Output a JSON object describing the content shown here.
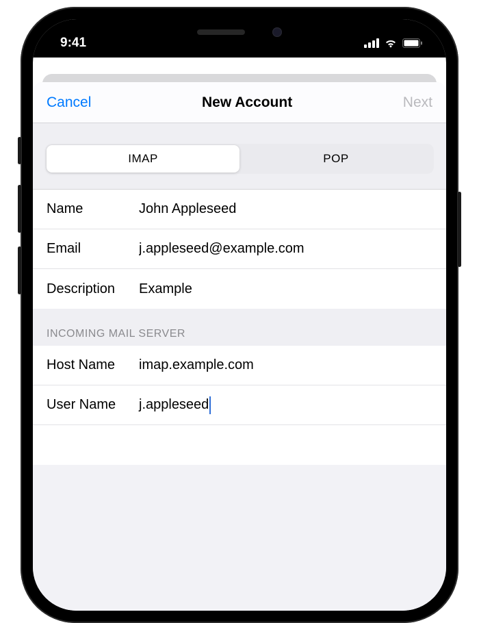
{
  "status": {
    "time": "9:41"
  },
  "nav": {
    "cancel": "Cancel",
    "title": "New Account",
    "next": "Next"
  },
  "segmented": {
    "imap": "IMAP",
    "pop": "POP",
    "active": "IMAP"
  },
  "account": {
    "name_label": "Name",
    "name_value": "John Appleseed",
    "email_label": "Email",
    "email_value": "j.appleseed@example.com",
    "description_label": "Description",
    "description_value": "Example"
  },
  "incoming": {
    "header": "Incoming Mail Server",
    "hostname_label": "Host Name",
    "hostname_value": "imap.example.com",
    "username_label": "User Name",
    "username_value": "j.appleseed"
  }
}
